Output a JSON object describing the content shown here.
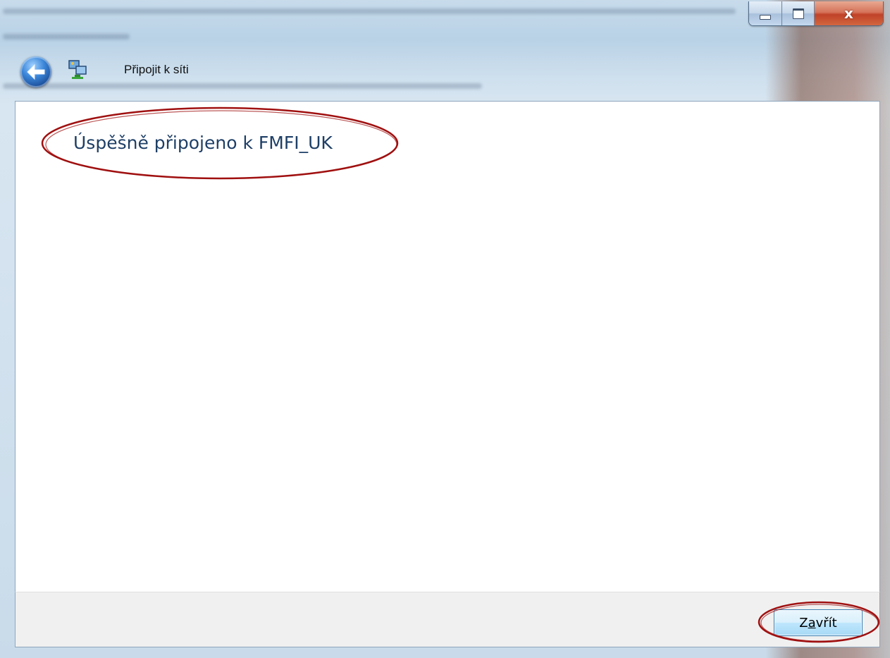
{
  "window": {
    "title": "Připojit k síti",
    "caption_buttons": {
      "minimize": "minimize-icon",
      "maximize": "maximize-icon",
      "close": "close-icon",
      "close_glyph": "x"
    }
  },
  "header": {
    "back_icon": "back-arrow-icon",
    "app_icon": "network-icon"
  },
  "content": {
    "message": "Úspěšně připojeno k FMFI_UK"
  },
  "footer": {
    "close_button": {
      "prefix": "Z",
      "accel": "a",
      "suffix": "vřít"
    }
  },
  "annotations": {
    "color": "#a01010"
  }
}
